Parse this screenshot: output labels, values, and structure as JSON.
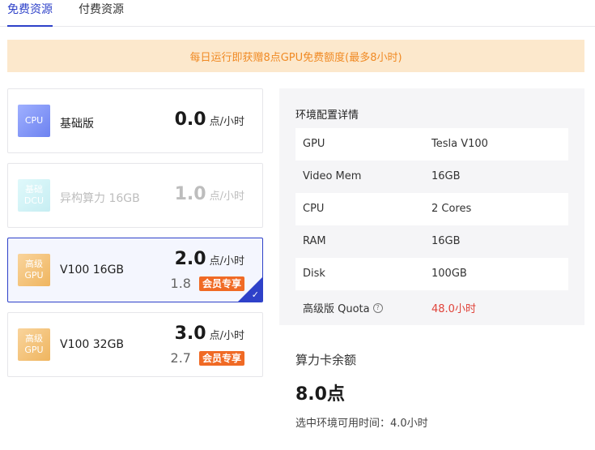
{
  "tabs": [
    {
      "label": "免费资源",
      "active": true
    },
    {
      "label": "付费资源",
      "active": false
    }
  ],
  "notice": "每日运行即获赠8点GPU免费额度(最多8小时)",
  "resources": [
    {
      "badge_line1": "CPU",
      "badge_line2": "",
      "name": "基础版",
      "price": "0.0",
      "unit": "点/小时",
      "member_price": "",
      "member_tag": "",
      "state": "normal"
    },
    {
      "badge_line1": "基础",
      "badge_line2": "DCU",
      "name": "异构算力 16GB",
      "price": "1.0",
      "unit": "点/小时",
      "member_price": "",
      "member_tag": "",
      "state": "disabled"
    },
    {
      "badge_line1": "高级",
      "badge_line2": "GPU",
      "name": "V100 16GB",
      "price": "2.0",
      "unit": "点/小时",
      "member_price": "1.8",
      "member_tag": "会员专享",
      "state": "selected"
    },
    {
      "badge_line1": "高级",
      "badge_line2": "GPU",
      "name": "V100 32GB",
      "price": "3.0",
      "unit": "点/小时",
      "member_price": "2.7",
      "member_tag": "会员专享",
      "state": "normal"
    }
  ],
  "config": {
    "title": "环境配置详情",
    "rows": [
      {
        "label": "GPU",
        "value": "Tesla V100"
      },
      {
        "label": "Video Mem",
        "value": "16GB"
      },
      {
        "label": "CPU",
        "value": "2 Cores"
      },
      {
        "label": "RAM",
        "value": "16GB"
      },
      {
        "label": "Disk",
        "value": "100GB"
      },
      {
        "label": "高级版 Quota",
        "value": "48.0小时"
      }
    ],
    "help_glyph": "?"
  },
  "balance": {
    "title": "算力卡余额",
    "value": "8.0点",
    "available_time": "选中环境可用时间：4.0小时"
  },
  "icons": {
    "check": "checkmark-icon",
    "help": "question-circle-icon"
  },
  "colors": {
    "accent": "#2e41c9",
    "notice_bg": "#fce8cc",
    "notice_text": "#f08a24",
    "member_tag": "#f06a25",
    "quota_red": "#e0433a"
  }
}
